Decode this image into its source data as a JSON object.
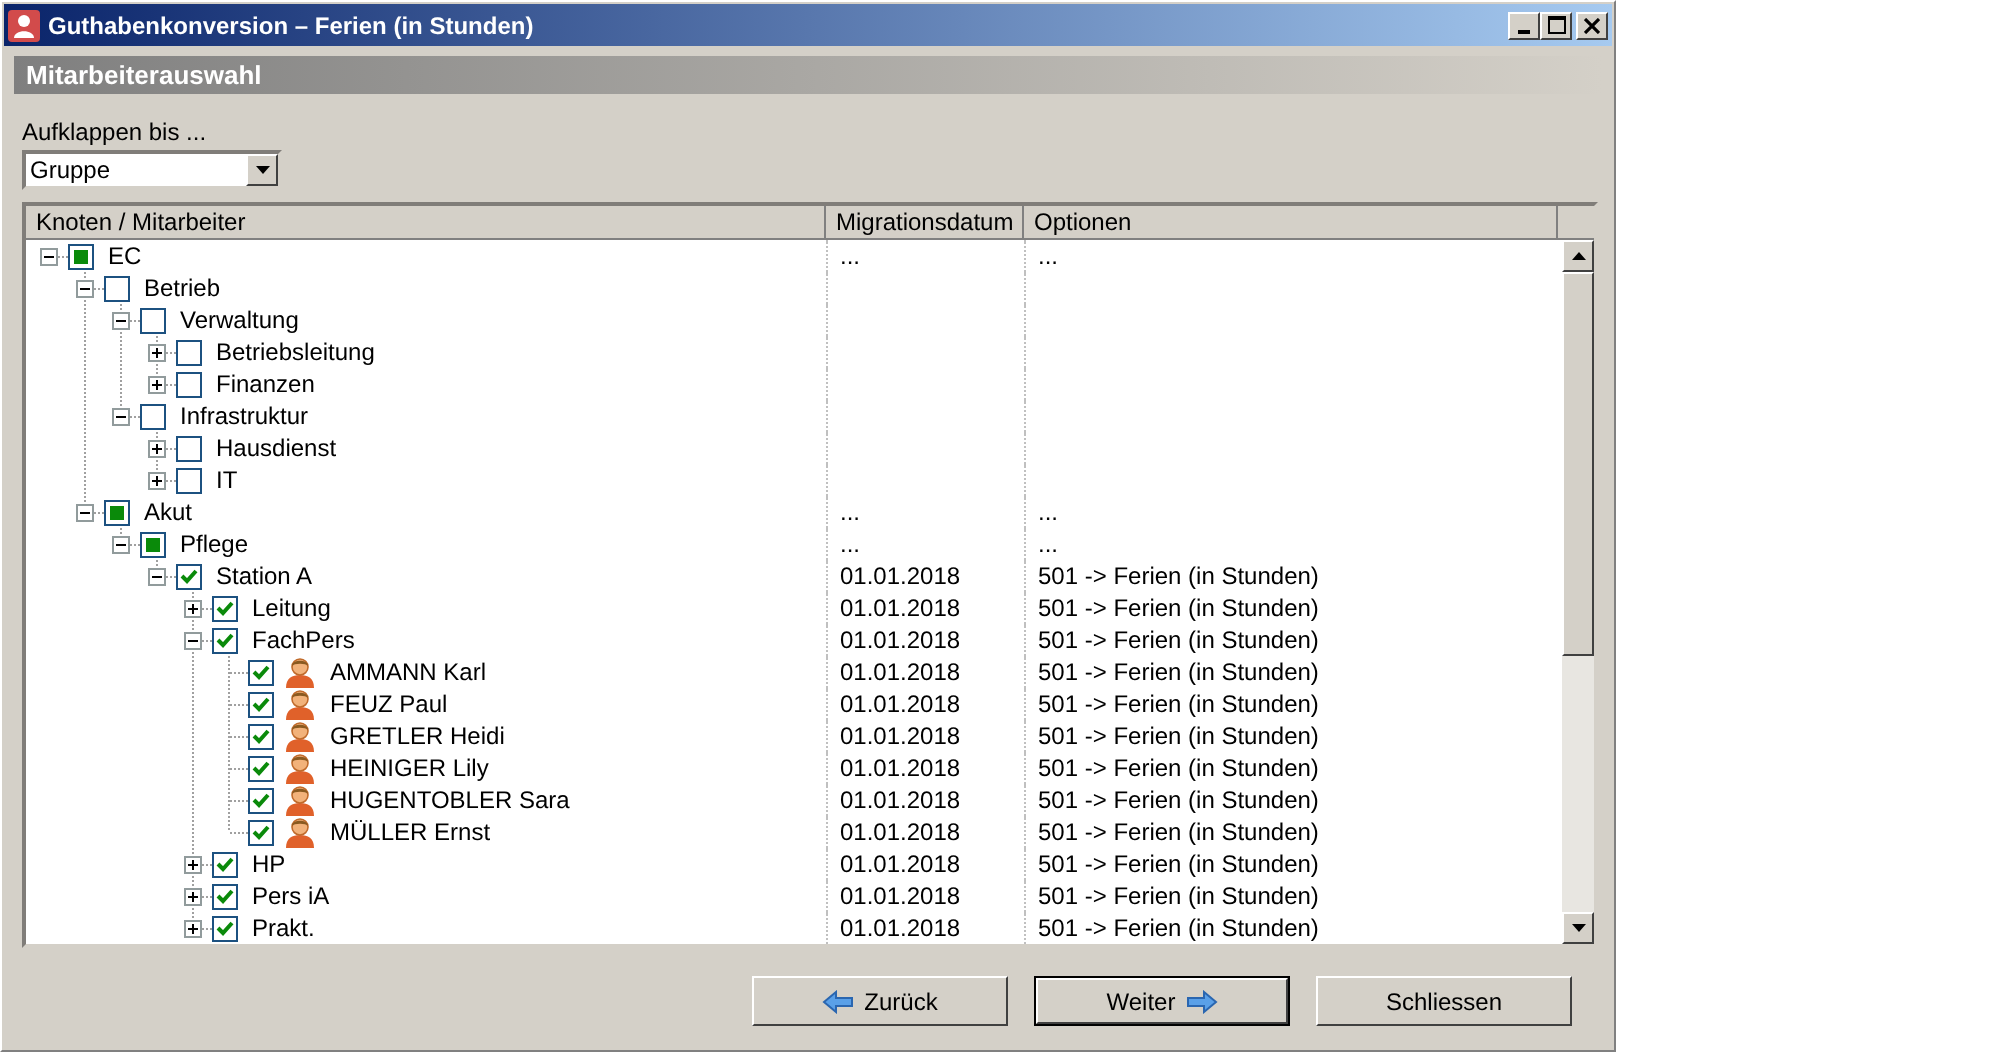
{
  "window": {
    "title": "Guthabenkonversion – Ferien (in Stunden)"
  },
  "section_header": "Mitarbeiterauswahl",
  "expand_to": {
    "label": "Aufklappen bis ...",
    "value": "Gruppe"
  },
  "tree": {
    "columns": [
      "Knoten / Mitarbeiter",
      "Migrationsdatum",
      "Optionen"
    ],
    "nodes": [
      {
        "kind": "group",
        "name": "EC",
        "checked": false,
        "partial": true,
        "expanded": true,
        "date": "...",
        "option": "...",
        "children": [
          {
            "kind": "group",
            "name": "Betrieb",
            "checked": false,
            "partial": false,
            "expanded": true,
            "children": [
              {
                "kind": "group",
                "name": "Verwaltung",
                "checked": false,
                "partial": false,
                "expanded": true,
                "children": [
                  {
                    "kind": "group",
                    "name": "Betriebsleitung",
                    "checked": false,
                    "partial": false,
                    "expanded": false
                  },
                  {
                    "kind": "group",
                    "name": "Finanzen",
                    "checked": false,
                    "partial": false,
                    "expanded": false
                  }
                ]
              },
              {
                "kind": "group",
                "name": "Infrastruktur",
                "checked": false,
                "partial": false,
                "expanded": true,
                "children": [
                  {
                    "kind": "group",
                    "name": "Hausdienst",
                    "checked": false,
                    "partial": false,
                    "expanded": false
                  },
                  {
                    "kind": "group",
                    "name": "IT",
                    "checked": false,
                    "partial": false,
                    "expanded": false
                  }
                ]
              }
            ]
          },
          {
            "kind": "group",
            "name": "Akut",
            "checked": false,
            "partial": true,
            "expanded": true,
            "date": "...",
            "option": "...",
            "children": [
              {
                "kind": "group",
                "name": "Pflege",
                "checked": false,
                "partial": true,
                "expanded": true,
                "date": "...",
                "option": "...",
                "children": [
                  {
                    "kind": "group",
                    "name": "Station A",
                    "checked": true,
                    "expanded": true,
                    "date": "01.01.2018",
                    "option": "501 -> Ferien (in Stunden)",
                    "children": [
                      {
                        "kind": "group",
                        "name": "Leitung",
                        "checked": true,
                        "expanded": false,
                        "date": "01.01.2018",
                        "option": "501 -> Ferien (in Stunden)"
                      },
                      {
                        "kind": "group",
                        "name": "FachPers",
                        "checked": true,
                        "expanded": true,
                        "date": "01.01.2018",
                        "option": "501 -> Ferien (in Stunden)",
                        "children": [
                          {
                            "kind": "person",
                            "name": "AMMANN Karl",
                            "checked": true,
                            "date": "01.01.2018",
                            "option": "501 -> Ferien (in Stunden)"
                          },
                          {
                            "kind": "person",
                            "name": "FEUZ Paul",
                            "checked": true,
                            "date": "01.01.2018",
                            "option": "501 -> Ferien (in Stunden)"
                          },
                          {
                            "kind": "person",
                            "name": "GRETLER Heidi",
                            "checked": true,
                            "date": "01.01.2018",
                            "option": "501 -> Ferien (in Stunden)"
                          },
                          {
                            "kind": "person",
                            "name": "HEINIGER Lily",
                            "checked": true,
                            "date": "01.01.2018",
                            "option": "501 -> Ferien (in Stunden)"
                          },
                          {
                            "kind": "person",
                            "name": "HUGENTOBLER Sara",
                            "checked": true,
                            "date": "01.01.2018",
                            "option": "501 -> Ferien (in Stunden)"
                          },
                          {
                            "kind": "person",
                            "name": "MÜLLER Ernst",
                            "checked": true,
                            "date": "01.01.2018",
                            "option": "501 -> Ferien (in Stunden)"
                          }
                        ]
                      },
                      {
                        "kind": "group",
                        "name": "HP",
                        "checked": true,
                        "expanded": false,
                        "date": "01.01.2018",
                        "option": "501 -> Ferien (in Stunden)"
                      },
                      {
                        "kind": "group",
                        "name": "Pers iA",
                        "checked": true,
                        "expanded": false,
                        "date": "01.01.2018",
                        "option": "501 -> Ferien (in Stunden)"
                      },
                      {
                        "kind": "group",
                        "name": "Prakt.",
                        "checked": true,
                        "expanded": false,
                        "date": "01.01.2018",
                        "option": "501 -> Ferien (in Stunden)"
                      }
                    ]
                  }
                ]
              }
            ]
          }
        ]
      }
    ]
  },
  "buttons": [
    {
      "label": "Zurück",
      "kind": "back",
      "default": false
    },
    {
      "label": "Weiter",
      "kind": "next",
      "default": true
    },
    {
      "label": "Schliessen",
      "kind": "close",
      "default": false
    }
  ]
}
